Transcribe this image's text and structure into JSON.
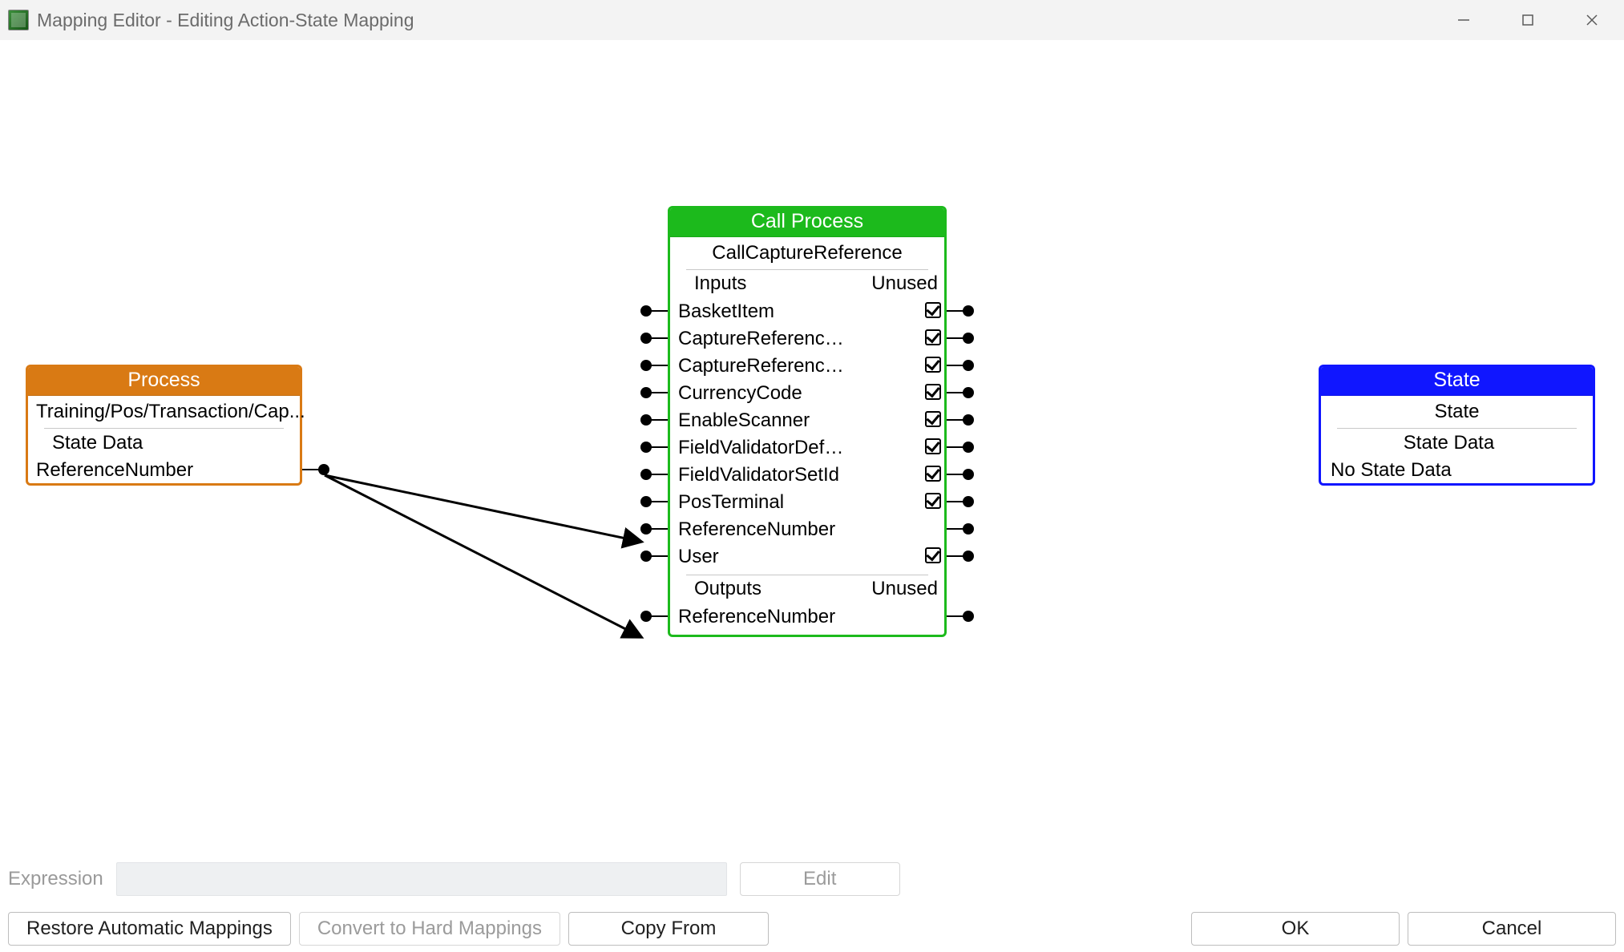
{
  "window": {
    "title": "Mapping Editor - Editing Action-State Mapping"
  },
  "process_node": {
    "title": "Process",
    "subtitle": "Training/Pos/Transaction/Cap...",
    "section": "State Data",
    "row": "ReferenceNumber"
  },
  "call_node": {
    "title": "Call Process",
    "subtitle": "CallCaptureReference",
    "inputs_header_left": "Inputs",
    "inputs_header_right": "Unused",
    "inputs": [
      {
        "label": "BasketItem",
        "checked": true
      },
      {
        "label": "CaptureReferenceP...",
        "checked": true
      },
      {
        "label": "CaptureReferenceP...",
        "checked": true
      },
      {
        "label": "CurrencyCode",
        "checked": true
      },
      {
        "label": "EnableScanner",
        "checked": true
      },
      {
        "label": "FieldValidatorDefini...",
        "checked": true
      },
      {
        "label": "FieldValidatorSetId",
        "checked": true
      },
      {
        "label": "PosTerminal",
        "checked": true
      },
      {
        "label": "ReferenceNumber",
        "checked": false
      },
      {
        "label": "User",
        "checked": true
      }
    ],
    "outputs_header_left": "Outputs",
    "outputs_header_right": "Unused",
    "outputs": [
      {
        "label": "ReferenceNumber",
        "checked": false
      }
    ]
  },
  "state_node": {
    "title": "State",
    "subtitle": "State",
    "section": "State Data",
    "row": "No State Data"
  },
  "footer": {
    "expression_label": "Expression",
    "edit": "Edit",
    "restore": "Restore Automatic Mappings",
    "convert": "Convert to Hard Mappings",
    "copy_from": "Copy From",
    "ok": "OK",
    "cancel": "Cancel"
  },
  "colors": {
    "process": "#d97a14",
    "call": "#1cba1c",
    "state": "#1016ff"
  }
}
